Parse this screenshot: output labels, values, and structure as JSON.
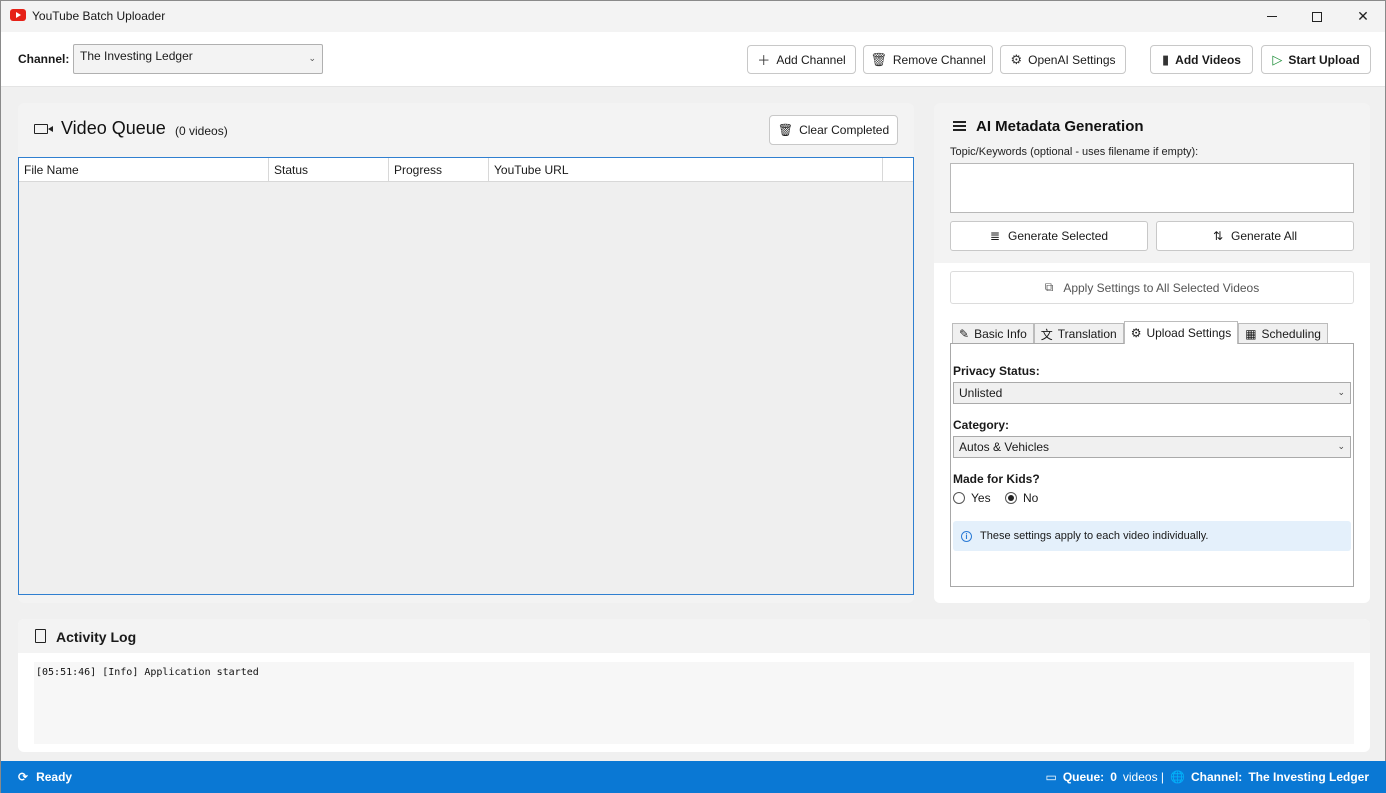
{
  "window": {
    "title": "YouTube Batch Uploader"
  },
  "toolbar": {
    "channel_label": "Channel:",
    "channel_value": "The Investing Ledger",
    "add_channel": "Add Channel",
    "remove_channel": "Remove Channel",
    "openai_settings": "OpenAI Settings",
    "add_videos": "Add Videos",
    "start_upload": "Start Upload"
  },
  "queue": {
    "title": "Video Queue",
    "count": "(0 videos)",
    "clear_completed": "Clear Completed",
    "columns": [
      "File Name",
      "Status",
      "Progress",
      "YouTube URL"
    ]
  },
  "ai": {
    "title": "AI Metadata Generation",
    "topic_label": "Topic/Keywords (optional - uses filename if empty):",
    "topic_value": "",
    "generate_selected": "Generate Selected",
    "generate_all": "Generate All",
    "apply_settings": "Apply Settings to All Selected Videos",
    "tabs": [
      "Basic Info",
      "Translation",
      "Upload Settings",
      "Scheduling"
    ],
    "active_tab": "Upload Settings",
    "privacy_label": "Privacy Status:",
    "privacy_value": "Unlisted",
    "category_label": "Category:",
    "category_value": "Autos & Vehicles",
    "kids_label": "Made for Kids?",
    "kids_yes": "Yes",
    "kids_no": "No",
    "kids_selected": "No",
    "info_text": "These settings apply to each video individually."
  },
  "log": {
    "title": "Activity Log",
    "lines": [
      "[05:51:46] [Info] Application started"
    ]
  },
  "status": {
    "state": "Ready",
    "queue_label": "Queue:",
    "queue_count": "0",
    "queue_unit": "videos |",
    "channel_label": "Channel:",
    "channel_value": "The Investing Ledger"
  },
  "colors": {
    "accent": "#0a78d4",
    "info_bg": "#e4f0fb",
    "brand_red": "#e62117"
  },
  "icons": [
    "youtube-icon",
    "plus-icon",
    "trash-icon",
    "gear-icon",
    "film-icon",
    "play-icon",
    "camera-icon",
    "list-icon",
    "sort-icon",
    "copy-icon",
    "pencil-icon",
    "translate-icon",
    "calendar-icon",
    "info-icon",
    "document-icon",
    "refresh-icon",
    "globe-icon"
  ]
}
